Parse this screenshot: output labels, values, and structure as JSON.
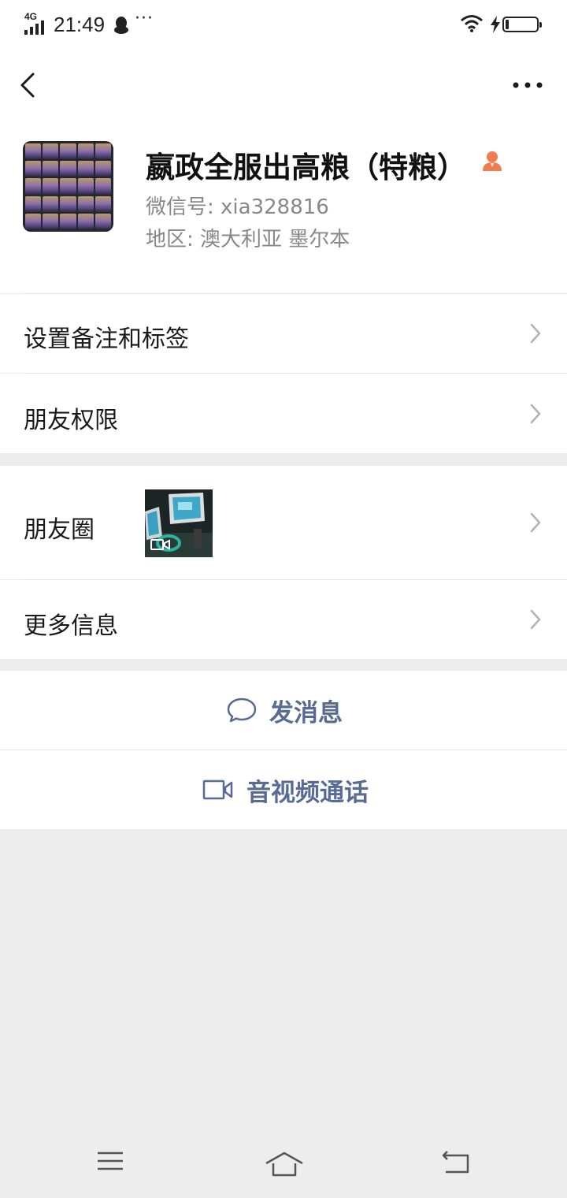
{
  "status_bar": {
    "network": "4G",
    "time": "21:49",
    "more": "···"
  },
  "profile": {
    "name": "嬴政全服出高粮（特粮）",
    "wechat_id": "微信号:  xia328816",
    "region": "地区:  澳大利亚  墨尔本"
  },
  "rows": {
    "remark_tags": "设置备注和标签",
    "friend_permissions": "朋友权限",
    "moments": "朋友圈",
    "more_info": "更多信息"
  },
  "actions": {
    "send_message": "发消息",
    "video_call": "音视频通话"
  },
  "colors": {
    "link_blue": "#576b95",
    "badge_orange": "#f07c50",
    "page_bg": "#ededed"
  },
  "icons": [
    "back-icon",
    "more-icon",
    "contact-badge-icon",
    "chevron-right-icon",
    "chat-bubble-icon",
    "video-camera-icon",
    "menu-icon",
    "home-icon",
    "return-icon"
  ]
}
